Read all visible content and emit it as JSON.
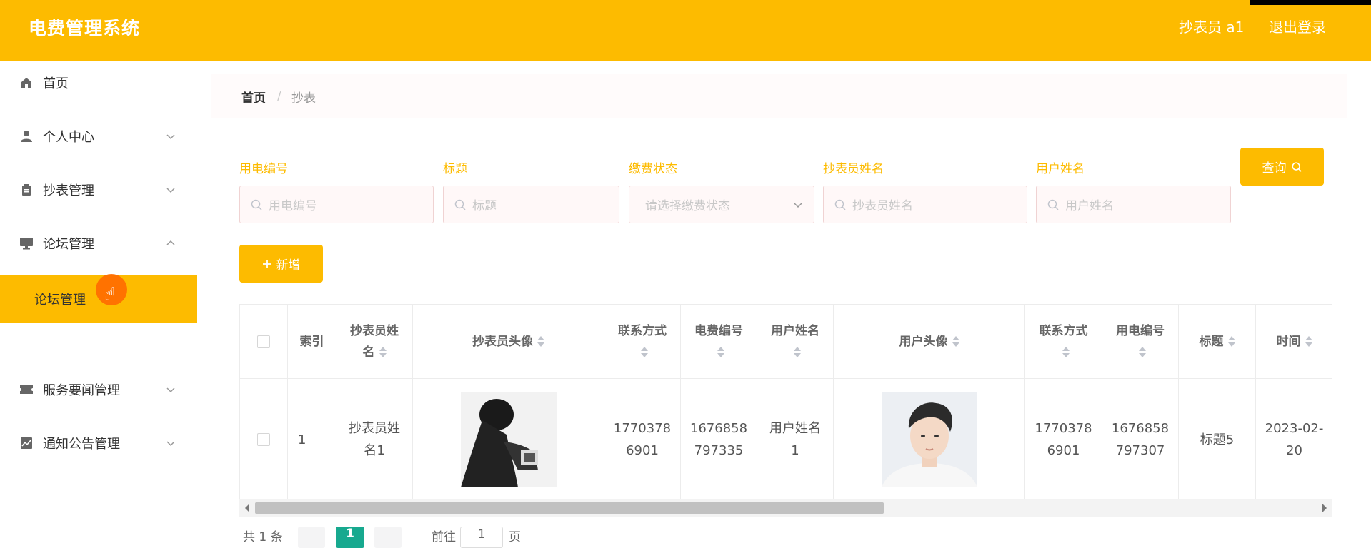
{
  "header": {
    "title": "电费管理系统",
    "user": "抄表员 a1",
    "logout": "退出登录"
  },
  "sidebar": {
    "items": [
      {
        "label": "首页",
        "icon": "home-icon"
      },
      {
        "label": "个人中心",
        "icon": "user-icon"
      },
      {
        "label": "抄表管理",
        "icon": "clipboard-icon"
      },
      {
        "label": "论坛管理",
        "icon": "monitor-icon"
      },
      {
        "label": "服务要闻管理",
        "icon": "ticket-icon"
      },
      {
        "label": "通知公告管理",
        "icon": "chart-icon"
      }
    ],
    "active_sub": "论坛管理"
  },
  "breadcrumb": {
    "home": "首页",
    "sep": "/",
    "current": "抄表"
  },
  "filters": [
    {
      "label": "用电编号",
      "placeholder": "用电编号"
    },
    {
      "label": "标题",
      "placeholder": "标题"
    },
    {
      "label": "缴费状态",
      "placeholder": "请选择缴费状态"
    },
    {
      "label": "抄表员姓名",
      "placeholder": "抄表员姓名"
    },
    {
      "label": "用户姓名",
      "placeholder": "用户姓名"
    }
  ],
  "buttons": {
    "query": "查询",
    "add": "新增"
  },
  "table": {
    "headers": [
      "索引",
      "抄表员姓名",
      "抄表员头像",
      "联系方式",
      "电费编号",
      "用户姓名",
      "用户头像",
      "联系方式",
      "用电编号",
      "标题",
      "时间"
    ],
    "rows": [
      {
        "index": "1",
        "reader_name": "抄表员姓名1",
        "reader_phone": "17703786901",
        "bill_no": "1676858797335",
        "user_name": "用户姓名1",
        "user_phone": "17703786901",
        "meter_no": "1676858797307",
        "title": "标题5",
        "time": "2023-02-20"
      }
    ]
  },
  "pagination": {
    "total": "共 1 条",
    "current": "1",
    "goto": "前往",
    "goto_value": "1",
    "page_unit": "页"
  },
  "colors": {
    "accent": "#fdbb00",
    "pager_active": "#17a98f"
  }
}
